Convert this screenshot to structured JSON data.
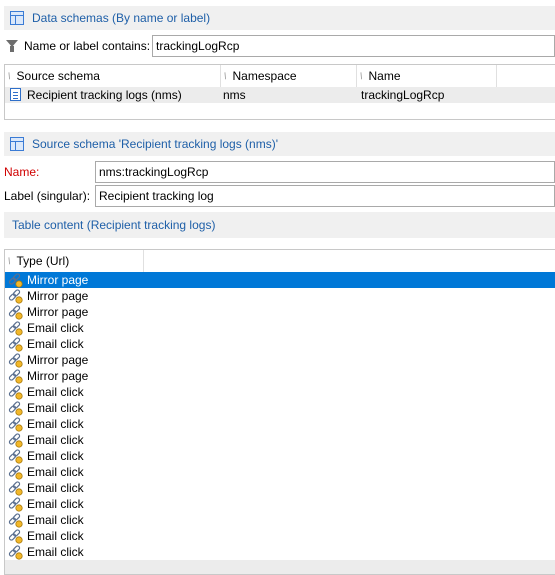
{
  "schemas_section": {
    "title": "Data schemas (By name or label)"
  },
  "filter": {
    "label": "Name or label contains:",
    "value": "trackingLogRcp"
  },
  "schema_list": {
    "columns": [
      "Source schema",
      "Namespace",
      "Name"
    ],
    "rows": [
      {
        "source_schema": "Recipient tracking logs (nms)",
        "namespace": "nms",
        "name": "trackingLogRcp"
      }
    ]
  },
  "source_section": {
    "title": "Source schema 'Recipient tracking logs (nms)'"
  },
  "form": {
    "name_label": "Name:",
    "name_value": "nms:trackingLogRcp",
    "label_label": "Label (singular):",
    "label_value": "Recipient tracking log"
  },
  "table_section": {
    "title": "Table content (Recipient tracking logs)"
  },
  "type_list": {
    "column": "Type (Url)",
    "selected_index": 0,
    "rows": [
      "Mirror page",
      "Mirror page",
      "Mirror page",
      "Email click",
      "Email click",
      "Mirror page",
      "Mirror page",
      "Email click",
      "Email click",
      "Email click",
      "Email click",
      "Email click",
      "Email click",
      "Email click",
      "Email click",
      "Email click",
      "Email click",
      "Email click"
    ]
  },
  "colors": {
    "accent": "#1e5fa8",
    "selection": "#0078d7",
    "required": "#d00000",
    "header_bg": "#f0f0f0"
  },
  "icons": {
    "section": "table-icon",
    "filter": "funnel-icon",
    "schema_row": "document-icon",
    "type_row": "link-icon"
  }
}
